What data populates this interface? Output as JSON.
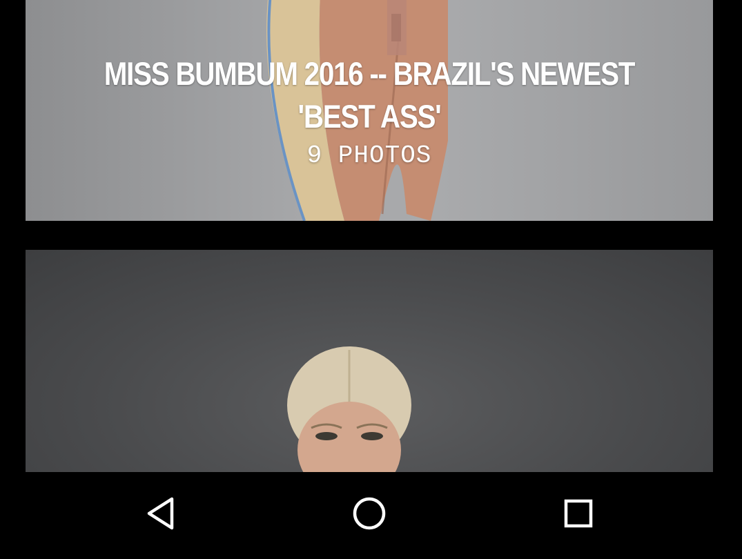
{
  "gallery_cards": [
    {
      "title": "MISS BUMBUM 2016 -- BRAZIL'S NEWEST 'BEST ASS'",
      "photo_count": "9 PHOTOS"
    },
    {
      "title": "",
      "photo_count": ""
    }
  ],
  "navigation": {
    "back_icon": "triangle-back-icon",
    "home_icon": "circle-home-icon",
    "recents_icon": "square-recents-icon"
  },
  "colors": {
    "background": "#000000",
    "text": "#ffffff",
    "card_1_bg": "#a6a7a9",
    "card_2_bg": "#4a4b4d"
  }
}
